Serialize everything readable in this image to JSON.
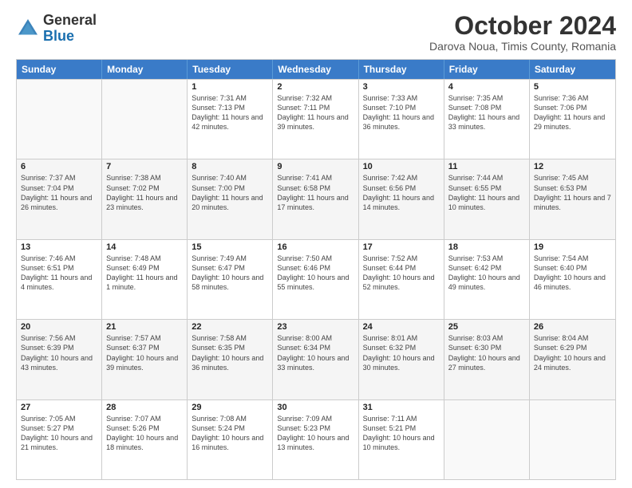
{
  "header": {
    "logo_general": "General",
    "logo_blue": "Blue",
    "month_title": "October 2024",
    "subtitle": "Darova Noua, Timis County, Romania"
  },
  "weekdays": [
    "Sunday",
    "Monday",
    "Tuesday",
    "Wednesday",
    "Thursday",
    "Friday",
    "Saturday"
  ],
  "weeks": [
    [
      {
        "day": "",
        "sunrise": "",
        "sunset": "",
        "daylight": "",
        "empty": true
      },
      {
        "day": "",
        "sunrise": "",
        "sunset": "",
        "daylight": "",
        "empty": true
      },
      {
        "day": "1",
        "sunrise": "Sunrise: 7:31 AM",
        "sunset": "Sunset: 7:13 PM",
        "daylight": "Daylight: 11 hours and 42 minutes.",
        "empty": false
      },
      {
        "day": "2",
        "sunrise": "Sunrise: 7:32 AM",
        "sunset": "Sunset: 7:11 PM",
        "daylight": "Daylight: 11 hours and 39 minutes.",
        "empty": false
      },
      {
        "day": "3",
        "sunrise": "Sunrise: 7:33 AM",
        "sunset": "Sunset: 7:10 PM",
        "daylight": "Daylight: 11 hours and 36 minutes.",
        "empty": false
      },
      {
        "day": "4",
        "sunrise": "Sunrise: 7:35 AM",
        "sunset": "Sunset: 7:08 PM",
        "daylight": "Daylight: 11 hours and 33 minutes.",
        "empty": false
      },
      {
        "day": "5",
        "sunrise": "Sunrise: 7:36 AM",
        "sunset": "Sunset: 7:06 PM",
        "daylight": "Daylight: 11 hours and 29 minutes.",
        "empty": false
      }
    ],
    [
      {
        "day": "6",
        "sunrise": "Sunrise: 7:37 AM",
        "sunset": "Sunset: 7:04 PM",
        "daylight": "Daylight: 11 hours and 26 minutes.",
        "empty": false
      },
      {
        "day": "7",
        "sunrise": "Sunrise: 7:38 AM",
        "sunset": "Sunset: 7:02 PM",
        "daylight": "Daylight: 11 hours and 23 minutes.",
        "empty": false
      },
      {
        "day": "8",
        "sunrise": "Sunrise: 7:40 AM",
        "sunset": "Sunset: 7:00 PM",
        "daylight": "Daylight: 11 hours and 20 minutes.",
        "empty": false
      },
      {
        "day": "9",
        "sunrise": "Sunrise: 7:41 AM",
        "sunset": "Sunset: 6:58 PM",
        "daylight": "Daylight: 11 hours and 17 minutes.",
        "empty": false
      },
      {
        "day": "10",
        "sunrise": "Sunrise: 7:42 AM",
        "sunset": "Sunset: 6:56 PM",
        "daylight": "Daylight: 11 hours and 14 minutes.",
        "empty": false
      },
      {
        "day": "11",
        "sunrise": "Sunrise: 7:44 AM",
        "sunset": "Sunset: 6:55 PM",
        "daylight": "Daylight: 11 hours and 10 minutes.",
        "empty": false
      },
      {
        "day": "12",
        "sunrise": "Sunrise: 7:45 AM",
        "sunset": "Sunset: 6:53 PM",
        "daylight": "Daylight: 11 hours and 7 minutes.",
        "empty": false
      }
    ],
    [
      {
        "day": "13",
        "sunrise": "Sunrise: 7:46 AM",
        "sunset": "Sunset: 6:51 PM",
        "daylight": "Daylight: 11 hours and 4 minutes.",
        "empty": false
      },
      {
        "day": "14",
        "sunrise": "Sunrise: 7:48 AM",
        "sunset": "Sunset: 6:49 PM",
        "daylight": "Daylight: 11 hours and 1 minute.",
        "empty": false
      },
      {
        "day": "15",
        "sunrise": "Sunrise: 7:49 AM",
        "sunset": "Sunset: 6:47 PM",
        "daylight": "Daylight: 10 hours and 58 minutes.",
        "empty": false
      },
      {
        "day": "16",
        "sunrise": "Sunrise: 7:50 AM",
        "sunset": "Sunset: 6:46 PM",
        "daylight": "Daylight: 10 hours and 55 minutes.",
        "empty": false
      },
      {
        "day": "17",
        "sunrise": "Sunrise: 7:52 AM",
        "sunset": "Sunset: 6:44 PM",
        "daylight": "Daylight: 10 hours and 52 minutes.",
        "empty": false
      },
      {
        "day": "18",
        "sunrise": "Sunrise: 7:53 AM",
        "sunset": "Sunset: 6:42 PM",
        "daylight": "Daylight: 10 hours and 49 minutes.",
        "empty": false
      },
      {
        "day": "19",
        "sunrise": "Sunrise: 7:54 AM",
        "sunset": "Sunset: 6:40 PM",
        "daylight": "Daylight: 10 hours and 46 minutes.",
        "empty": false
      }
    ],
    [
      {
        "day": "20",
        "sunrise": "Sunrise: 7:56 AM",
        "sunset": "Sunset: 6:39 PM",
        "daylight": "Daylight: 10 hours and 43 minutes.",
        "empty": false
      },
      {
        "day": "21",
        "sunrise": "Sunrise: 7:57 AM",
        "sunset": "Sunset: 6:37 PM",
        "daylight": "Daylight: 10 hours and 39 minutes.",
        "empty": false
      },
      {
        "day": "22",
        "sunrise": "Sunrise: 7:58 AM",
        "sunset": "Sunset: 6:35 PM",
        "daylight": "Daylight: 10 hours and 36 minutes.",
        "empty": false
      },
      {
        "day": "23",
        "sunrise": "Sunrise: 8:00 AM",
        "sunset": "Sunset: 6:34 PM",
        "daylight": "Daylight: 10 hours and 33 minutes.",
        "empty": false
      },
      {
        "day": "24",
        "sunrise": "Sunrise: 8:01 AM",
        "sunset": "Sunset: 6:32 PM",
        "daylight": "Daylight: 10 hours and 30 minutes.",
        "empty": false
      },
      {
        "day": "25",
        "sunrise": "Sunrise: 8:03 AM",
        "sunset": "Sunset: 6:30 PM",
        "daylight": "Daylight: 10 hours and 27 minutes.",
        "empty": false
      },
      {
        "day": "26",
        "sunrise": "Sunrise: 8:04 AM",
        "sunset": "Sunset: 6:29 PM",
        "daylight": "Daylight: 10 hours and 24 minutes.",
        "empty": false
      }
    ],
    [
      {
        "day": "27",
        "sunrise": "Sunrise: 7:05 AM",
        "sunset": "Sunset: 5:27 PM",
        "daylight": "Daylight: 10 hours and 21 minutes.",
        "empty": false
      },
      {
        "day": "28",
        "sunrise": "Sunrise: 7:07 AM",
        "sunset": "Sunset: 5:26 PM",
        "daylight": "Daylight: 10 hours and 18 minutes.",
        "empty": false
      },
      {
        "day": "29",
        "sunrise": "Sunrise: 7:08 AM",
        "sunset": "Sunset: 5:24 PM",
        "daylight": "Daylight: 10 hours and 16 minutes.",
        "empty": false
      },
      {
        "day": "30",
        "sunrise": "Sunrise: 7:09 AM",
        "sunset": "Sunset: 5:23 PM",
        "daylight": "Daylight: 10 hours and 13 minutes.",
        "empty": false
      },
      {
        "day": "31",
        "sunrise": "Sunrise: 7:11 AM",
        "sunset": "Sunset: 5:21 PM",
        "daylight": "Daylight: 10 hours and 10 minutes.",
        "empty": false
      },
      {
        "day": "",
        "sunrise": "",
        "sunset": "",
        "daylight": "",
        "empty": true
      },
      {
        "day": "",
        "sunrise": "",
        "sunset": "",
        "daylight": "",
        "empty": true
      }
    ]
  ]
}
